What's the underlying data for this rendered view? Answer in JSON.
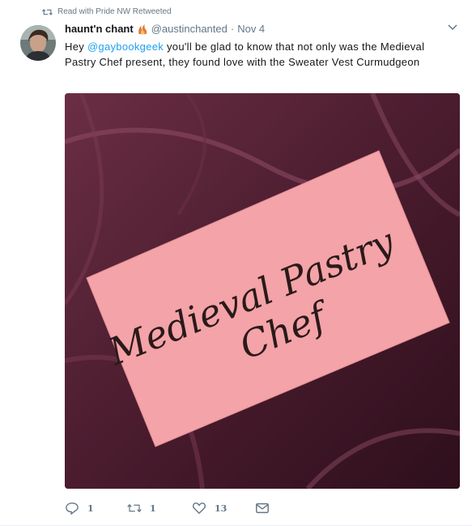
{
  "retweet_context": {
    "text": "Read with Pride NW Retweeted",
    "icon": "retweet-icon"
  },
  "author": {
    "display_name": "haunt'n chant",
    "badge_emoji": "fire-emoji",
    "handle": "@austinchanted",
    "separator": "·",
    "date": "Nov 4"
  },
  "tweet": {
    "text_before": "Hey ",
    "mention": "@gaybookgeek",
    "text_after": " you'll be glad to know that not only was the Medieval Pastry Chef present, they found love with the Sweater Vest Curmudgeon"
  },
  "media": {
    "note_line1": "Medieval Pastry",
    "note_line2": "Chef"
  },
  "actions": {
    "reply_count": "1",
    "retweet_count": "1",
    "like_count": "13"
  },
  "colors": {
    "accent": "#1da1f2",
    "muted": "#657786",
    "note": "#f4a3a8",
    "fabric": "#4a1c2e"
  }
}
